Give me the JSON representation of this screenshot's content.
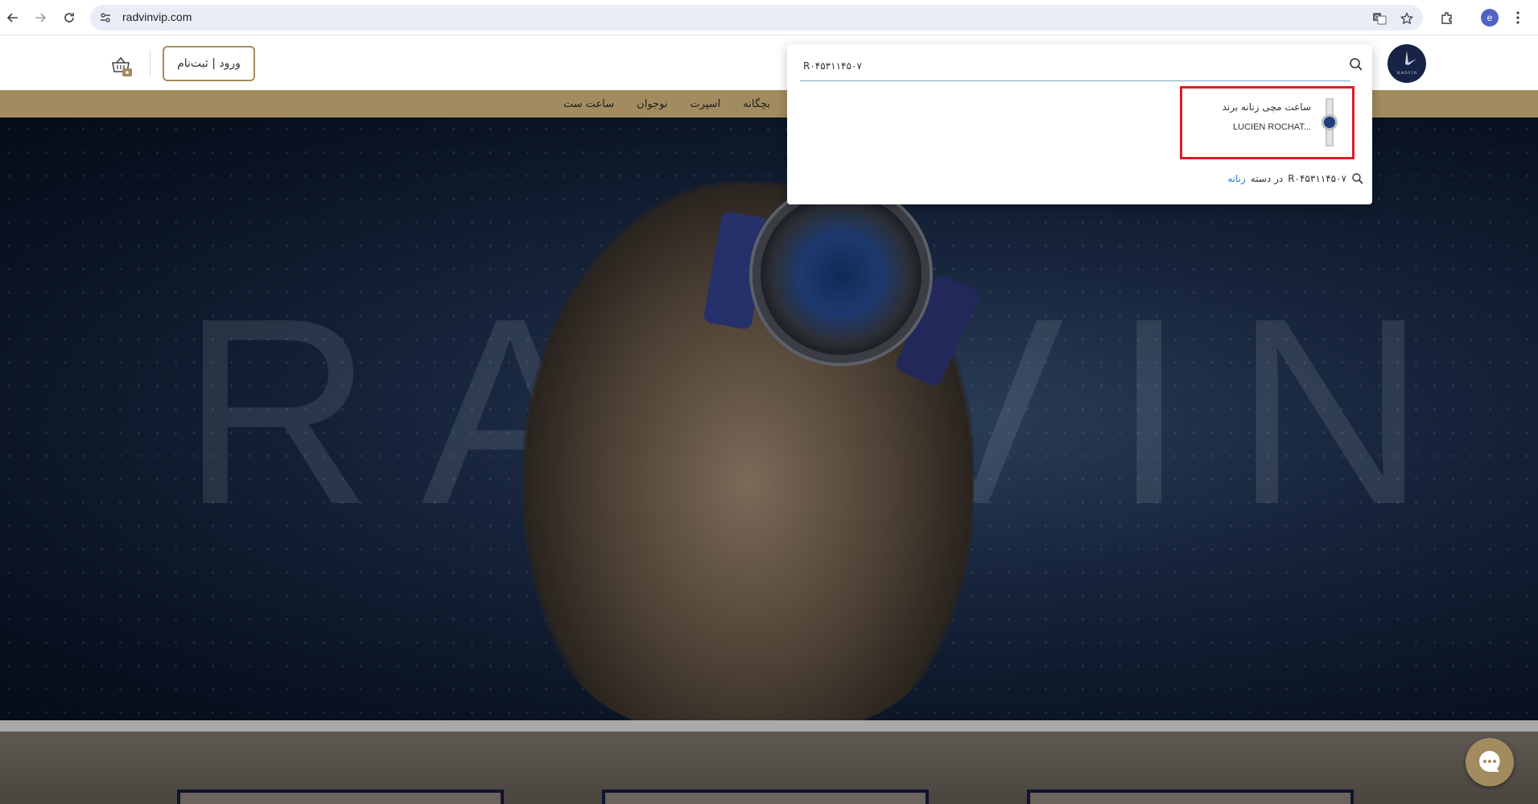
{
  "browser": {
    "url": "radvinvip.com",
    "profile_initial": "e"
  },
  "header": {
    "login_label": "ورود | ثبت‌نام",
    "logo_text": "RADVIN"
  },
  "menu": {
    "items": [
      "ساعت ست",
      "نوجوان",
      "اسپرت",
      "بچگانه"
    ]
  },
  "search": {
    "query": "R۰۴۵۳۱۱۴۵۰۷",
    "result": {
      "title": "ساعت مچی زنانه برند",
      "brand": "LUCIEN ROCHAT..."
    },
    "suggestion": {
      "query": "R۰۴۵۳۱۱۴۵۰۷",
      "in_label": "در دسته",
      "category": "زنانه"
    }
  },
  "hero": {
    "background_text": "RADVIN"
  },
  "colors": {
    "gold": "#a28c5f",
    "navy": "#172346",
    "highlight": "#e01b24",
    "link": "#2a7ad3"
  }
}
